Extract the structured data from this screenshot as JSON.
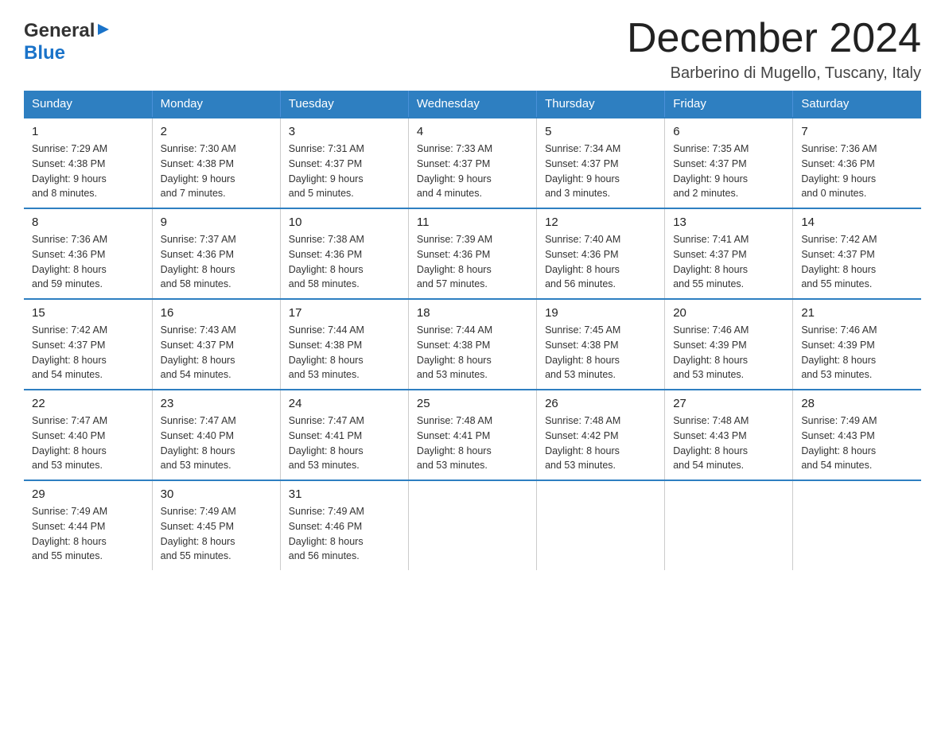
{
  "logo": {
    "line1": "General",
    "arrow": "▶",
    "line2": "Blue"
  },
  "title": "December 2024",
  "subtitle": "Barberino di Mugello, Tuscany, Italy",
  "days_of_week": [
    "Sunday",
    "Monday",
    "Tuesday",
    "Wednesday",
    "Thursday",
    "Friday",
    "Saturday"
  ],
  "weeks": [
    [
      {
        "day": "1",
        "sunrise": "7:29 AM",
        "sunset": "4:38 PM",
        "daylight": "9 hours and 8 minutes."
      },
      {
        "day": "2",
        "sunrise": "7:30 AM",
        "sunset": "4:38 PM",
        "daylight": "9 hours and 7 minutes."
      },
      {
        "day": "3",
        "sunrise": "7:31 AM",
        "sunset": "4:37 PM",
        "daylight": "9 hours and 5 minutes."
      },
      {
        "day": "4",
        "sunrise": "7:33 AM",
        "sunset": "4:37 PM",
        "daylight": "9 hours and 4 minutes."
      },
      {
        "day": "5",
        "sunrise": "7:34 AM",
        "sunset": "4:37 PM",
        "daylight": "9 hours and 3 minutes."
      },
      {
        "day": "6",
        "sunrise": "7:35 AM",
        "sunset": "4:37 PM",
        "daylight": "9 hours and 2 minutes."
      },
      {
        "day": "7",
        "sunrise": "7:36 AM",
        "sunset": "4:36 PM",
        "daylight": "9 hours and 0 minutes."
      }
    ],
    [
      {
        "day": "8",
        "sunrise": "7:36 AM",
        "sunset": "4:36 PM",
        "daylight": "8 hours and 59 minutes."
      },
      {
        "day": "9",
        "sunrise": "7:37 AM",
        "sunset": "4:36 PM",
        "daylight": "8 hours and 58 minutes."
      },
      {
        "day": "10",
        "sunrise": "7:38 AM",
        "sunset": "4:36 PM",
        "daylight": "8 hours and 58 minutes."
      },
      {
        "day": "11",
        "sunrise": "7:39 AM",
        "sunset": "4:36 PM",
        "daylight": "8 hours and 57 minutes."
      },
      {
        "day": "12",
        "sunrise": "7:40 AM",
        "sunset": "4:36 PM",
        "daylight": "8 hours and 56 minutes."
      },
      {
        "day": "13",
        "sunrise": "7:41 AM",
        "sunset": "4:37 PM",
        "daylight": "8 hours and 55 minutes."
      },
      {
        "day": "14",
        "sunrise": "7:42 AM",
        "sunset": "4:37 PM",
        "daylight": "8 hours and 55 minutes."
      }
    ],
    [
      {
        "day": "15",
        "sunrise": "7:42 AM",
        "sunset": "4:37 PM",
        "daylight": "8 hours and 54 minutes."
      },
      {
        "day": "16",
        "sunrise": "7:43 AM",
        "sunset": "4:37 PM",
        "daylight": "8 hours and 54 minutes."
      },
      {
        "day": "17",
        "sunrise": "7:44 AM",
        "sunset": "4:38 PM",
        "daylight": "8 hours and 53 minutes."
      },
      {
        "day": "18",
        "sunrise": "7:44 AM",
        "sunset": "4:38 PM",
        "daylight": "8 hours and 53 minutes."
      },
      {
        "day": "19",
        "sunrise": "7:45 AM",
        "sunset": "4:38 PM",
        "daylight": "8 hours and 53 minutes."
      },
      {
        "day": "20",
        "sunrise": "7:46 AM",
        "sunset": "4:39 PM",
        "daylight": "8 hours and 53 minutes."
      },
      {
        "day": "21",
        "sunrise": "7:46 AM",
        "sunset": "4:39 PM",
        "daylight": "8 hours and 53 minutes."
      }
    ],
    [
      {
        "day": "22",
        "sunrise": "7:47 AM",
        "sunset": "4:40 PM",
        "daylight": "8 hours and 53 minutes."
      },
      {
        "day": "23",
        "sunrise": "7:47 AM",
        "sunset": "4:40 PM",
        "daylight": "8 hours and 53 minutes."
      },
      {
        "day": "24",
        "sunrise": "7:47 AM",
        "sunset": "4:41 PM",
        "daylight": "8 hours and 53 minutes."
      },
      {
        "day": "25",
        "sunrise": "7:48 AM",
        "sunset": "4:41 PM",
        "daylight": "8 hours and 53 minutes."
      },
      {
        "day": "26",
        "sunrise": "7:48 AM",
        "sunset": "4:42 PM",
        "daylight": "8 hours and 53 minutes."
      },
      {
        "day": "27",
        "sunrise": "7:48 AM",
        "sunset": "4:43 PM",
        "daylight": "8 hours and 54 minutes."
      },
      {
        "day": "28",
        "sunrise": "7:49 AM",
        "sunset": "4:43 PM",
        "daylight": "8 hours and 54 minutes."
      }
    ],
    [
      {
        "day": "29",
        "sunrise": "7:49 AM",
        "sunset": "4:44 PM",
        "daylight": "8 hours and 55 minutes."
      },
      {
        "day": "30",
        "sunrise": "7:49 AM",
        "sunset": "4:45 PM",
        "daylight": "8 hours and 55 minutes."
      },
      {
        "day": "31",
        "sunrise": "7:49 AM",
        "sunset": "4:46 PM",
        "daylight": "8 hours and 56 minutes."
      },
      null,
      null,
      null,
      null
    ]
  ]
}
